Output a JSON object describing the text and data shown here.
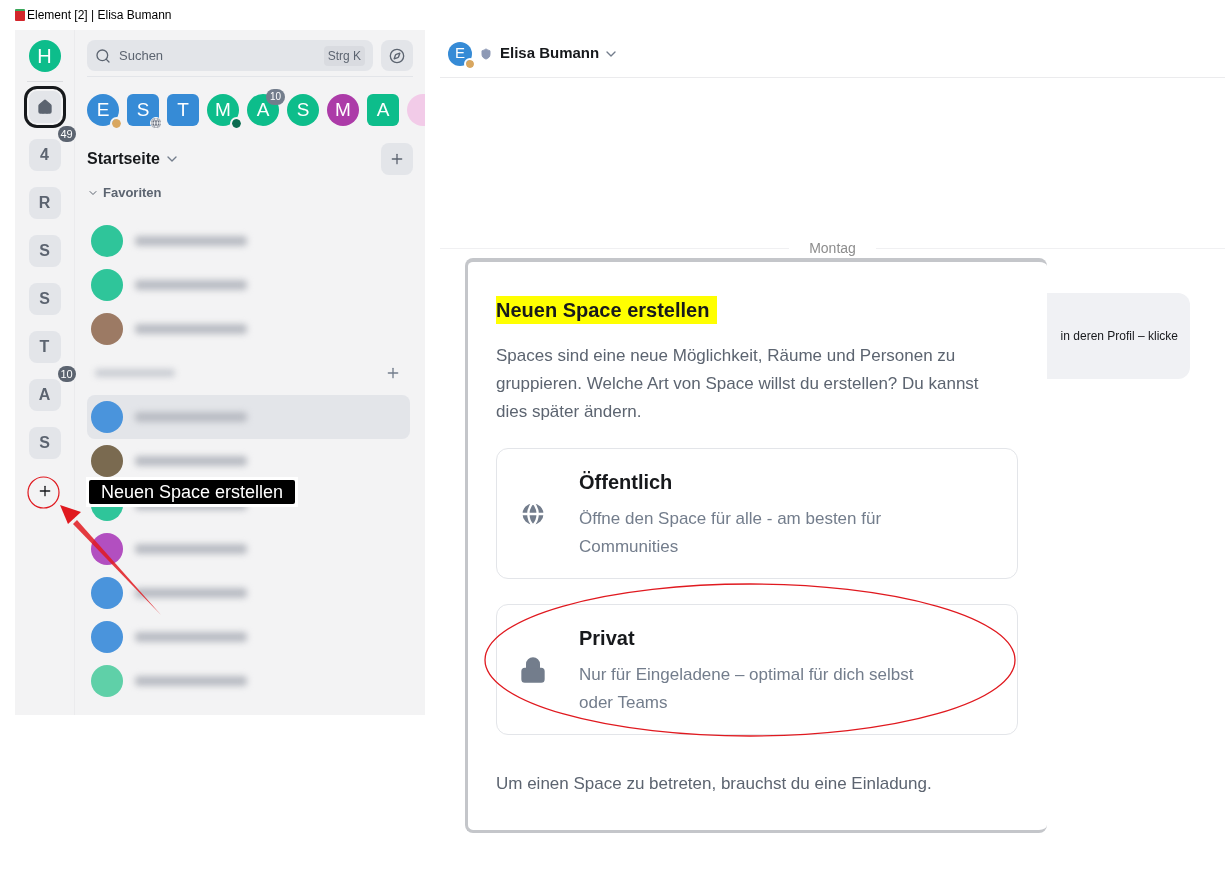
{
  "window": {
    "title": "Element [2] | Elisa Bumann"
  },
  "space_rail": {
    "account_avatar": "H",
    "items": [
      {
        "kind": "home",
        "selected": true
      },
      {
        "kind": "space",
        "label": "4",
        "selected": false,
        "badge": "49"
      },
      {
        "kind": "space",
        "label": "R",
        "selected": false
      },
      {
        "kind": "space",
        "label": "S",
        "selected": false
      },
      {
        "kind": "space",
        "label": "S",
        "selected": false
      },
      {
        "kind": "space",
        "label": "T",
        "selected": false
      },
      {
        "kind": "space",
        "label": "A",
        "selected": false,
        "badge": "10"
      },
      {
        "kind": "space",
        "label": "S",
        "selected": false
      }
    ]
  },
  "search": {
    "placeholder": "Suchen",
    "shortcut": "Strg K"
  },
  "recent_rooms": [
    {
      "kind": "person",
      "letter": "E",
      "color": "#368bd6",
      "presence_dot": {
        "color": "#d9a760"
      }
    },
    {
      "kind": "room",
      "letter": "S",
      "color": "#368bd6",
      "public": true
    },
    {
      "kind": "room",
      "letter": "T",
      "color": "#368bd6"
    },
    {
      "kind": "person",
      "letter": "M",
      "color": "#0dbd8b",
      "presence_dot": {
        "color": "#0b6b50"
      }
    },
    {
      "kind": "person",
      "letter": "A",
      "color": "#0dbd8b",
      "badge": "10"
    },
    {
      "kind": "person",
      "letter": "S",
      "color": "#0dbd8b"
    },
    {
      "kind": "person",
      "letter": "M",
      "color": "#ac3ba8"
    },
    {
      "kind": "room",
      "letter": "A",
      "color": "#0dbd8b"
    },
    {
      "kind": "person",
      "color": "#f2cbe8"
    }
  ],
  "home_header": {
    "title": "Startseite"
  },
  "favorites_section": {
    "title": "Favoriten"
  },
  "blurred_rows": [
    {
      "kind": "row",
      "color": "#2fc59a"
    },
    {
      "kind": "row",
      "color": "#2fc59a"
    },
    {
      "kind": "row",
      "color": "#9c7a64"
    },
    {
      "kind": "header"
    },
    {
      "kind": "selected",
      "color": "#4a94dc"
    },
    {
      "kind": "row",
      "color": "#7a6a50"
    },
    {
      "kind": "row",
      "color": "#2fc59a"
    },
    {
      "kind": "row",
      "color": "#b24fc0"
    },
    {
      "kind": "row",
      "color": "#4a94dc"
    },
    {
      "kind": "row",
      "color": "#4a94dc"
    },
    {
      "kind": "row",
      "color": "#5fd0a8"
    }
  ],
  "room_header": {
    "avatar": "E",
    "presence_dot": {
      "color": "#d9a760"
    },
    "name": "Elisa Bumann"
  },
  "timeline": {
    "date_separator": "Montag",
    "message_fragment": "in deren Profil – klicke"
  },
  "dialog": {
    "title": "Neuen Space erstellen",
    "description": "Spaces sind eine neue Möglichkeit, Räume und Personen zu gruppieren. Welche Art von Space willst du erstellen? Du kannst dies später ändern.",
    "options": [
      {
        "kind": "public",
        "title": "Öffentlich",
        "description": "Öffne den Space für alle - am besten für Communities",
        "highlighted": false
      },
      {
        "kind": "private",
        "title": "Privat",
        "description": "Nur für Eingeladene – optimal für dich selbst oder Teams",
        "highlighted": true
      }
    ],
    "footer": "Um einen Space zu betreten, brauchst du eine Einladung."
  },
  "annotation": {
    "label": "Neuen Space erstellen"
  }
}
